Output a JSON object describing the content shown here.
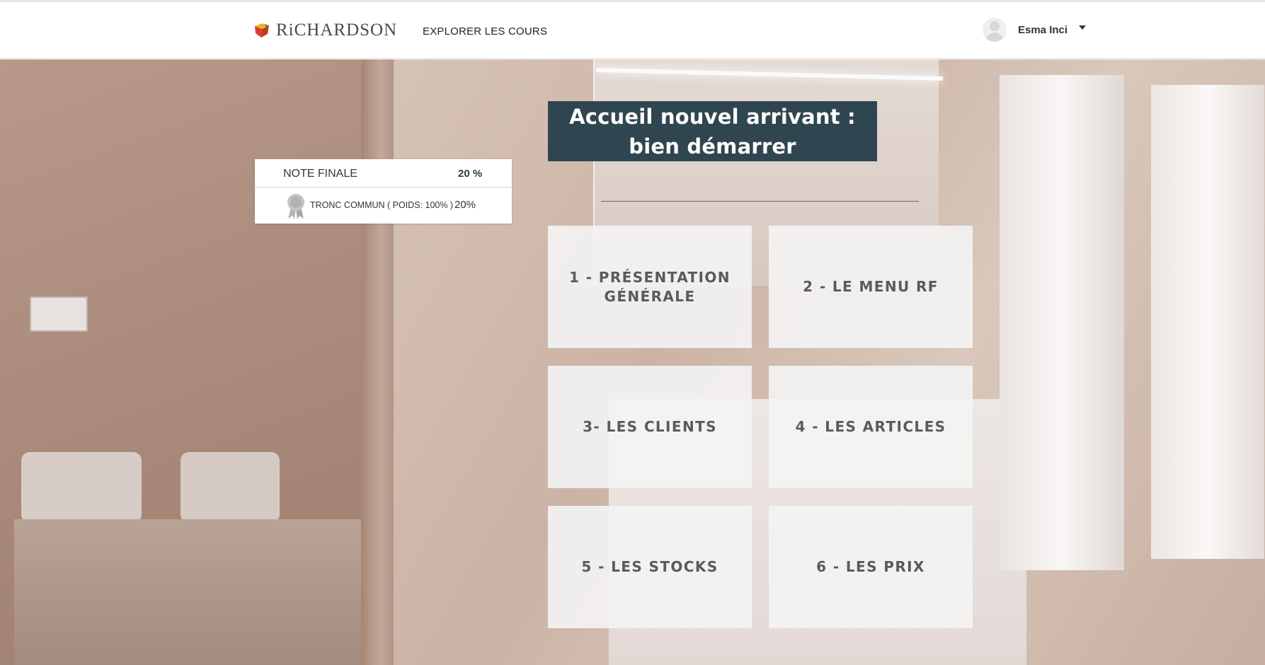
{
  "header": {
    "logo_text": "RiCHARDSON",
    "nav_explore": "EXPLORER LES COURS",
    "user_name": "Esma Inci"
  },
  "score": {
    "final_label": "NOTE FINALE",
    "final_value": "20 %",
    "tronc_label": "TRONC COMMUN ( POIDS: 100% )",
    "tronc_value": "20%"
  },
  "course": {
    "title": "Accueil nouvel arrivant :\nbien démarrer"
  },
  "tiles": [
    {
      "label": "1 - PRÉSENTATION\nGÉNÉRALE"
    },
    {
      "label": "2 - LE MENU RF"
    },
    {
      "label": "3- LES CLIENTS"
    },
    {
      "label": "4 - LES ARTICLES"
    },
    {
      "label": "5 - LES STOCKS"
    },
    {
      "label": "6 - LES PRIX"
    }
  ],
  "colors": {
    "title_bg": "#2f4650",
    "logo_red": "#d7402a",
    "logo_green": "#2f8f3a",
    "logo_yellow": "#f2b01e"
  },
  "icons": {
    "logo": "richardson-cube-logo",
    "avatar": "user-avatar-icon",
    "dropdown": "caret-down-icon",
    "badge": "award-ribbon-icon"
  }
}
